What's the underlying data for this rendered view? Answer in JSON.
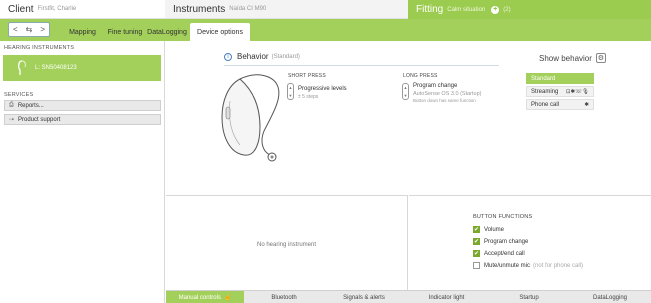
{
  "header": {
    "client_title": "Client",
    "client_name": "Firstfit, Charlie",
    "instruments_title": "Instruments",
    "instruments_name": "Naída CI M90",
    "fitting_title": "Fitting",
    "fitting_situation": "Calm situation",
    "fitting_count": "(2)",
    "add_label": "+"
  },
  "nav": {
    "back_forward_label": "< ≒ >"
  },
  "tabs": [
    {
      "label": "Mapping"
    },
    {
      "label": "Fine tuning"
    },
    {
      "label": "DataLogging"
    },
    {
      "label": "Device options"
    }
  ],
  "sidebar": {
    "hearing_title": "HEARING INSTRUMENTS",
    "hearing_item": "L: SN50408123",
    "services_title": "SERVICES",
    "services": [
      {
        "label": "Reports..."
      },
      {
        "label": "Product support"
      }
    ]
  },
  "behavior": {
    "title": "Behavior",
    "subtitle": "(Standard)",
    "short_press_title": "SHORT PRESS",
    "short_press_value": "Progressive levels",
    "short_press_sub": "± 5 steps",
    "long_press_title": "LONG PRESS",
    "long_press_value": "Program change",
    "long_press_sub1": "AutoSense OS 3.0 (Startup)",
    "long_press_sub2": "Button down has same function"
  },
  "show_behavior": {
    "title": "Show behavior",
    "options": [
      {
        "label": "Standard",
        "icons": ""
      },
      {
        "label": "Streaming",
        "icons": "⊡✱☏🎙"
      },
      {
        "label": "Phone call",
        "icons": "✱"
      }
    ],
    "selected": "Standard"
  },
  "bottom": {
    "no_hearing_instrument": "No hearing instrument",
    "button_functions_title": "BUTTON FUNCTIONS",
    "functions": [
      {
        "label": "Volume",
        "checked": true,
        "note": ""
      },
      {
        "label": "Program change",
        "checked": true,
        "note": ""
      },
      {
        "label": "Accept/end call",
        "checked": true,
        "note": ""
      },
      {
        "label": "Mute/unmute mic",
        "checked": false,
        "note": "(not for phone call)"
      }
    ]
  },
  "bottom_tabs": [
    {
      "label": "Manual controls"
    },
    {
      "label": "Bluetooth"
    },
    {
      "label": "Signals & alerts"
    },
    {
      "label": "Indicator light"
    },
    {
      "label": "Startup"
    },
    {
      "label": "DataLogging"
    }
  ],
  "colors": {
    "accent_green": "#a3d05a",
    "check_green": "#7aa82c",
    "info_blue": "#4a7fbf"
  },
  "icons": {
    "checkmark": "✔",
    "hand": "☝"
  }
}
